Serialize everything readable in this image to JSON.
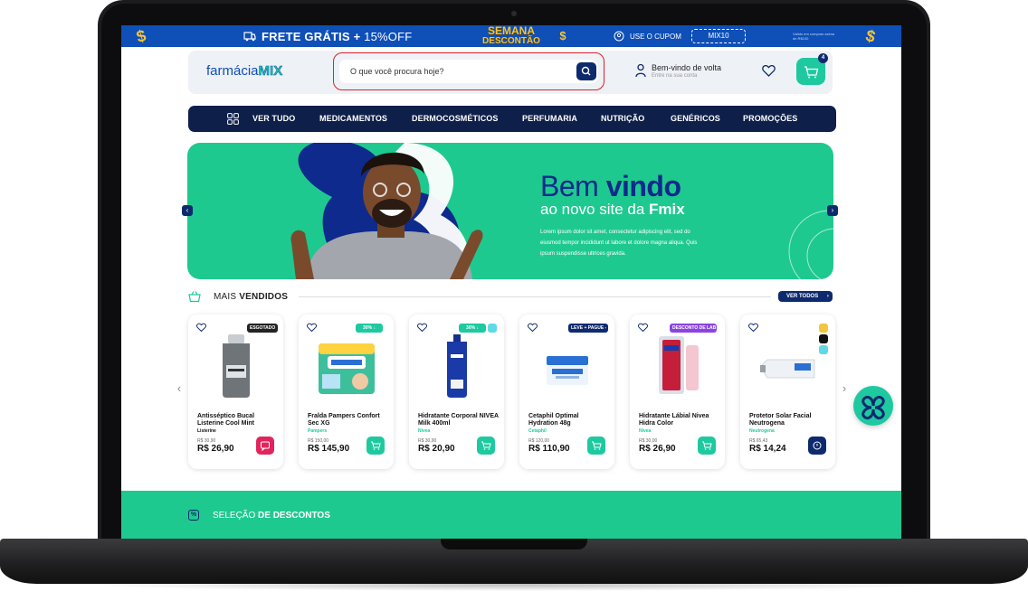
{
  "promo_bar": {
    "frete": "FRETE GRÁTIS",
    "plus": "+",
    "off": "15%OFF",
    "semana_line1": "SEMANA",
    "semana_line2": "DESCONTÃO",
    "cupom_label": "USE O CUPOM",
    "cupom_code": "MIX10",
    "valid_text": "Válido em compras acima de R$100",
    "coin_symbol": "$",
    "colors": {
      "bar": "#0e4fb8",
      "coin": "#f3c53a"
    }
  },
  "header": {
    "logo_text": "farmácia",
    "logo_mix": "MIX",
    "search_placeholder": "O que você procura hoje?",
    "welcome": "Bem-vindo de volta",
    "login": "Entre na sua conta",
    "cart_count": "4"
  },
  "nav": {
    "items": [
      "VER TUDO",
      "MEDICAMENTOS",
      "DERMOCOSMÉTICOS",
      "PERFUMARIA",
      "NUTRIÇÃO",
      "GENÉRICOS",
      "PROMOÇÕES"
    ]
  },
  "hero": {
    "title_light": "Bem ",
    "title_bold": "vindo",
    "subtitle_light": "ao novo site da ",
    "subtitle_bold": "Fmix",
    "lorem": "Lorem ipsum dolor sit amet, consectetur adipiscing elit, sed do eiusmod tempor incididunt ut labore et dolore magna aliqua. Quis ipsum suspendisse ultrices gravida.",
    "prev_arrow": "‹",
    "next_arrow": "›"
  },
  "best_sellers": {
    "title_light": "MAIS ",
    "title_bold": "VENDIDOS",
    "view_all": "VER TODOS",
    "products": [
      {
        "name": "Antisséptico Bucal Listerine Cool Mint",
        "brand": "Listerine",
        "old_price": "R$ 30,90",
        "price": "R$ 26,90",
        "tag": "ESGOTADO",
        "tag_color": "#222222",
        "cta_color": "#e0245e"
      },
      {
        "name": "Fralda Pampers Confort Sec XG",
        "brand": "Pampers",
        "old_price": "R$ 150,00",
        "price": "R$ 145,90",
        "tag": "30% ↓",
        "tag_color": "#1ec9a0",
        "cta_color": "#1ec9a0"
      },
      {
        "name": "Hidratante Corporal NIVEA Milk 400ml",
        "brand": "Nivea",
        "old_price": "R$ 30,90",
        "price": "R$ 20,90",
        "tag": "30% ↓",
        "tag_color": "#1ec9a0",
        "cta_color": "#1ec9a0"
      },
      {
        "name": "Cetaphil Optimal Hydration 48g",
        "brand": "Cetaphil",
        "old_price": "R$ 120,00",
        "price": "R$ 110,90",
        "tag": "LEVE + PAGUE -",
        "tag_color": "#0e2a6e",
        "cta_color": "#1ec9a0"
      },
      {
        "name": "Hidratante Lábial Nivea Hidra Color",
        "brand": "Nivea",
        "old_price": "R$ 30,00",
        "price": "R$ 26,90",
        "tag": "DESCONTO DE LAB",
        "tag_color": "#8b44e0",
        "cta_color": "#1ec9a0"
      },
      {
        "name": "Protetor Solar Facial Neutrogena",
        "brand": "Neutrogena",
        "old_price": "R$ 65,43",
        "price": "R$ 14,24",
        "tag": "",
        "tag_color": "#ffffff",
        "cta_color": "#0e2a6e"
      }
    ],
    "prev_arrow": "‹",
    "next_arrow": "›"
  },
  "discounts": {
    "icon": "%",
    "title_light": "SELEÇÃO ",
    "title_bold": "DE DESCONTOS"
  }
}
